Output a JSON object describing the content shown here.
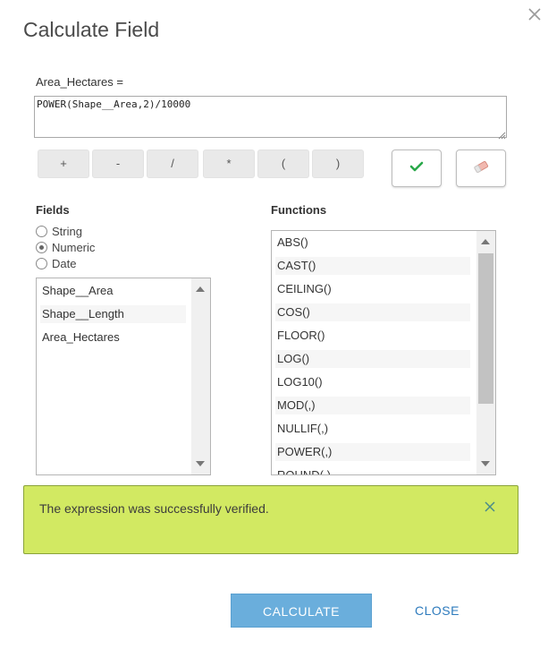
{
  "dialog": {
    "title": "Calculate Field",
    "close_icon": "close-icon"
  },
  "expression": {
    "label": "Area_Hectares =",
    "value": "POWER(Shape__Area,2)/10000"
  },
  "operators": [
    "+",
    "-",
    "/",
    "*",
    "(",
    ")"
  ],
  "tools": {
    "verify_icon": "check-icon",
    "verify_color": "#2aa84a",
    "clear_icon": "eraser-icon",
    "clear_color": "#e8a8a0"
  },
  "fields": {
    "heading": "Fields",
    "types": [
      {
        "label": "String",
        "selected": false
      },
      {
        "label": "Numeric",
        "selected": true
      },
      {
        "label": "Date",
        "selected": false
      }
    ],
    "items": [
      "Shape__Area",
      "Shape__Length",
      "Area_Hectares"
    ]
  },
  "functions": {
    "heading": "Functions",
    "items": [
      "ABS()",
      "CAST()",
      "CEILING()",
      "COS()",
      "FLOOR()",
      "LOG()",
      "LOG10()",
      "MOD(,)",
      "NULLIF(,)",
      "POWER(,)",
      "ROUND(,)"
    ]
  },
  "banner": {
    "message": "The expression was successfully verified.",
    "background": "#d2e962",
    "close_icon": "close-icon"
  },
  "footer": {
    "calculate_label": "CALCULATE",
    "close_label": "CLOSE",
    "accent": "#6aaedc"
  }
}
